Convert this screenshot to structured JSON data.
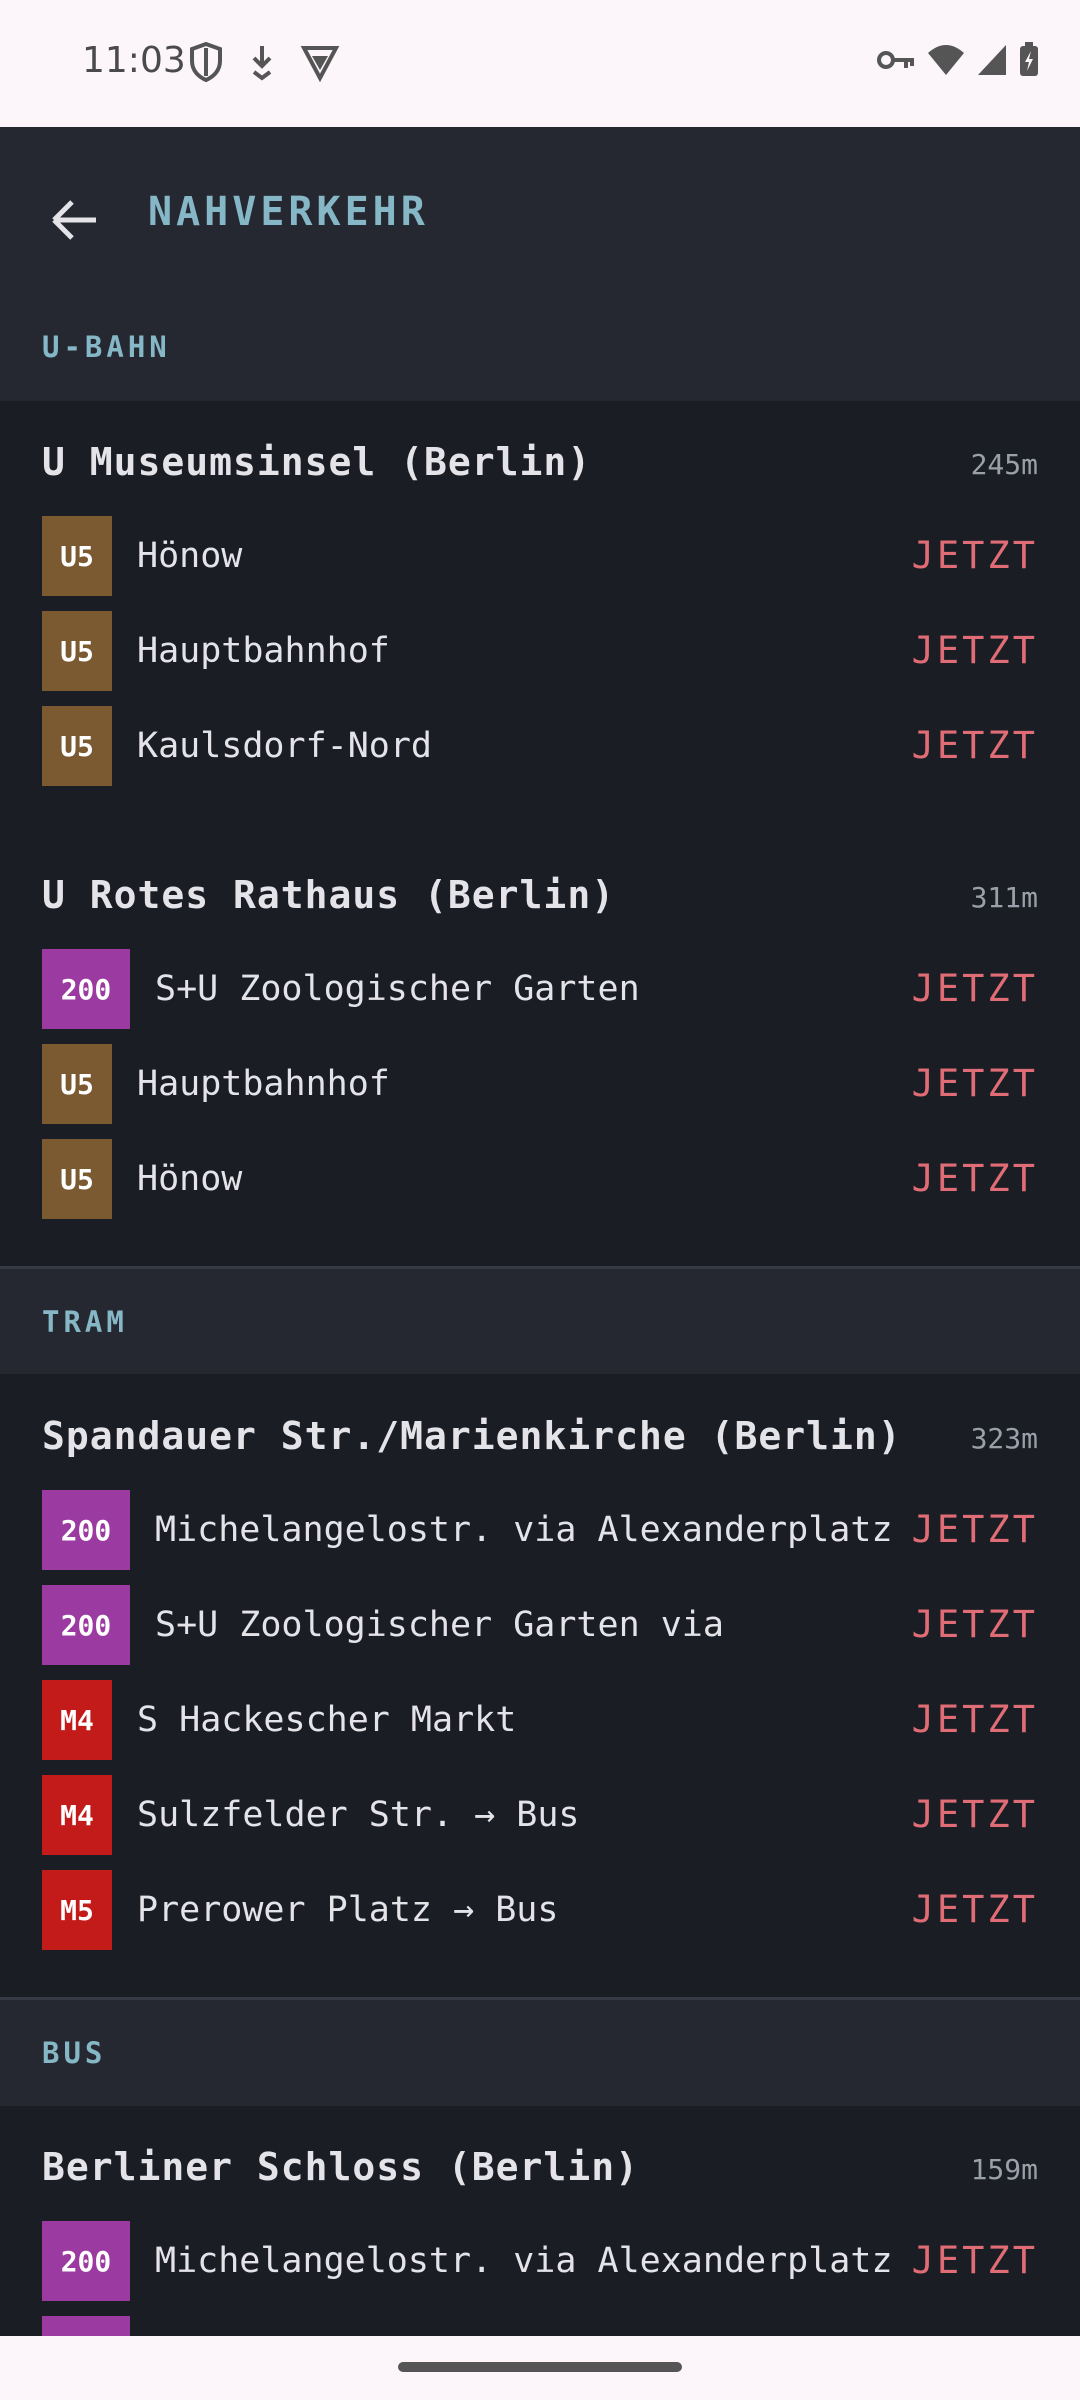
{
  "status_bar": {
    "time": "11:03",
    "left_icons": [
      "shield-icon",
      "download-icon",
      "vpn-icon"
    ],
    "right_icons": [
      "key-icon",
      "wifi-icon",
      "signal-icon",
      "battery-icon"
    ]
  },
  "app_bar": {
    "title": "NAHVERKEHR"
  },
  "sections": [
    {
      "label": "U-BAHN",
      "stations": [
        {
          "name": "U Museumsinsel (Berlin)",
          "distance": "245m",
          "departures": [
            {
              "line": "U5",
              "color": "#7b5a32",
              "dest": "Hönow",
              "when": "JETZT"
            },
            {
              "line": "U5",
              "color": "#7b5a32",
              "dest": "Hauptbahnhof",
              "when": "JETZT"
            },
            {
              "line": "U5",
              "color": "#7b5a32",
              "dest": "Kaulsdorf-Nord",
              "when": "JETZT"
            }
          ]
        },
        {
          "name": "U Rotes Rathaus (Berlin)",
          "distance": "311m",
          "departures": [
            {
              "line": "200",
              "color": "#9b3aa0",
              "dest": "S+U Zoologischer Garten",
              "when": "JETZT"
            },
            {
              "line": "U5",
              "color": "#7b5a32",
              "dest": "Hauptbahnhof",
              "when": "JETZT"
            },
            {
              "line": "U5",
              "color": "#7b5a32",
              "dest": "Hönow",
              "when": "JETZT"
            }
          ]
        }
      ]
    },
    {
      "label": "TRAM",
      "stations": [
        {
          "name": "Spandauer Str./Marienkirche (Berlin)",
          "distance": "323m",
          "departures": [
            {
              "line": "200",
              "color": "#9b3aa0",
              "dest": "Michelangelostr. via Alexanderplatz",
              "when": "JETZT"
            },
            {
              "line": "200",
              "color": "#9b3aa0",
              "dest": "S+U Zoologischer Garten via",
              "when": "JETZT"
            },
            {
              "line": "M4",
              "color": "#c31a1a",
              "dest": "S Hackescher Markt",
              "when": "JETZT"
            },
            {
              "line": "M4",
              "color": "#c31a1a",
              "dest": "Sulzfelder Str. → Bus",
              "when": "JETZT"
            },
            {
              "line": "M5",
              "color": "#c31a1a",
              "dest": "Prerower Platz → Bus",
              "when": "JETZT"
            }
          ]
        }
      ]
    },
    {
      "label": "BUS",
      "stations": [
        {
          "name": "Berliner Schloss (Berlin)",
          "distance": "159m",
          "departures": [
            {
              "line": "200",
              "color": "#9b3aa0",
              "dest": "Michelangelostr. via Alexanderplatz",
              "when": "JETZT"
            }
          ]
        }
      ]
    }
  ]
}
